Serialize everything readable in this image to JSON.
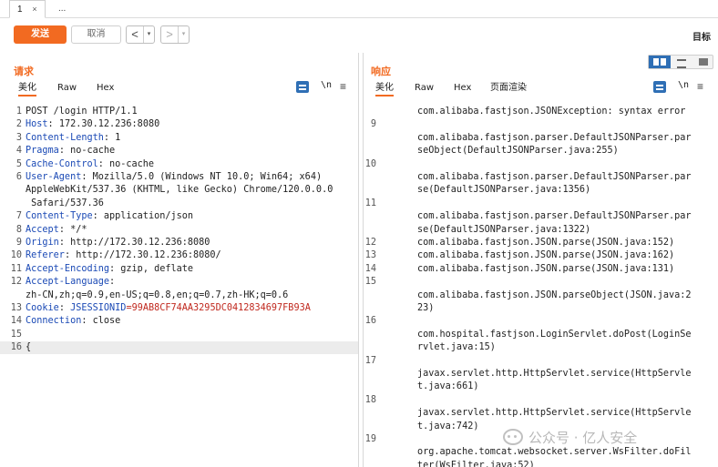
{
  "tabs": [
    {
      "label": "1",
      "close": "×"
    },
    {
      "label": "..."
    }
  ],
  "toolbar": {
    "send_label": "发送",
    "cancel_label": "取消",
    "back_arrow": "<",
    "forward_arrow": ">",
    "dropdown_glyph": "▾",
    "target_label": "目标"
  },
  "request": {
    "title": "请求",
    "subtabs": [
      "美化",
      "Raw",
      "Hex"
    ],
    "active_subtab": "美化",
    "newline_toggle": "\\n",
    "menu_glyph": "≡",
    "lines": [
      {
        "n": "1",
        "parts": [
          {
            "t": "POST /login HTTP/1.1",
            "c": "plain"
          }
        ]
      },
      {
        "n": "2",
        "parts": [
          {
            "t": "Host",
            "c": "hdr"
          },
          {
            "t": ": 172.30.12.236:8080",
            "c": "plain"
          }
        ]
      },
      {
        "n": "3",
        "parts": [
          {
            "t": "Content-Length",
            "c": "hdr"
          },
          {
            "t": ": 1",
            "c": "plain"
          }
        ]
      },
      {
        "n": "4",
        "parts": [
          {
            "t": "Pragma",
            "c": "hdr"
          },
          {
            "t": ": no-cache",
            "c": "plain"
          }
        ]
      },
      {
        "n": "5",
        "parts": [
          {
            "t": "Cache-Control",
            "c": "hdr"
          },
          {
            "t": ": no-cache",
            "c": "plain"
          }
        ]
      },
      {
        "n": "6",
        "parts": [
          {
            "t": "User-Agent",
            "c": "hdr"
          },
          {
            "t": ": Mozilla/5.0 (Windows NT 10.0; Win64; x64)",
            "c": "plain"
          }
        ]
      },
      {
        "n": "",
        "parts": [
          {
            "t": "AppleWebKit/537.36 (KHTML, like Gecko) Chrome/120.0.0.0",
            "c": "plain"
          }
        ]
      },
      {
        "n": "",
        "parts": [
          {
            "t": " Safari/537.36",
            "c": "plain"
          }
        ]
      },
      {
        "n": "7",
        "parts": [
          {
            "t": "Content-Type",
            "c": "hdr"
          },
          {
            "t": ": application/json",
            "c": "plain"
          }
        ]
      },
      {
        "n": "8",
        "parts": [
          {
            "t": "Accept",
            "c": "hdr"
          },
          {
            "t": ": */*",
            "c": "plain"
          }
        ]
      },
      {
        "n": "9",
        "parts": [
          {
            "t": "Origin",
            "c": "hdr"
          },
          {
            "t": ": http://172.30.12.236:8080",
            "c": "plain"
          }
        ]
      },
      {
        "n": "10",
        "parts": [
          {
            "t": "Referer",
            "c": "hdr"
          },
          {
            "t": ": http://172.30.12.236:8080/",
            "c": "plain"
          }
        ]
      },
      {
        "n": "11",
        "parts": [
          {
            "t": "Accept-Encoding",
            "c": "hdr"
          },
          {
            "t": ": gzip, deflate",
            "c": "plain"
          }
        ]
      },
      {
        "n": "12",
        "parts": [
          {
            "t": "Accept-Language",
            "c": "hdr"
          },
          {
            "t": ":",
            "c": "plain"
          }
        ]
      },
      {
        "n": "",
        "parts": [
          {
            "t": "zh-CN,zh;q=0.9,en-US;q=0.8,en;q=0.7,zh-HK;q=0.6",
            "c": "plain"
          }
        ]
      },
      {
        "n": "13",
        "parts": [
          {
            "t": "Cookie",
            "c": "hdr"
          },
          {
            "t": ": ",
            "c": "plain"
          },
          {
            "t": "JSESSIONID",
            "c": "hdr"
          },
          {
            "t": "=99AB8CF74AA3295DC0412834697FB93A",
            "c": "cookie-val"
          }
        ]
      },
      {
        "n": "14",
        "parts": [
          {
            "t": "Connection",
            "c": "hdr"
          },
          {
            "t": ": close",
            "c": "plain"
          }
        ]
      },
      {
        "n": "15",
        "parts": []
      },
      {
        "n": "16",
        "parts": [
          {
            "t": "{",
            "c": "plain"
          }
        ],
        "current": true
      }
    ]
  },
  "response": {
    "title": "响应",
    "subtabs": [
      "美化",
      "Raw",
      "Hex",
      "页面渲染"
    ],
    "active_subtab": "美化",
    "newline_toggle": "\\n",
    "menu_glyph": "≡",
    "lines": [
      {
        "n": "",
        "t": "com.alibaba.fastjson.JSONException: syntax error",
        "row": 0
      },
      {
        "n": "9",
        "t": "",
        "row": 1
      },
      {
        "n": "",
        "t": "com.alibaba.fastjson.parser.DefaultJSONParser.par",
        "row": 2
      },
      {
        "n": "",
        "t": "seObject(DefaultJSONParser.java:255)",
        "row": 3
      },
      {
        "n": "10",
        "t": "",
        "row": 4
      },
      {
        "n": "",
        "t": "com.alibaba.fastjson.parser.DefaultJSONParser.par",
        "row": 5
      },
      {
        "n": "",
        "t": "se(DefaultJSONParser.java:1356)",
        "row": 6
      },
      {
        "n": "11",
        "t": "",
        "row": 7
      },
      {
        "n": "",
        "t": "com.alibaba.fastjson.parser.DefaultJSONParser.par",
        "row": 8
      },
      {
        "n": "",
        "t": "se(DefaultJSONParser.java:1322)",
        "row": 9
      },
      {
        "n": "12",
        "t": "com.alibaba.fastjson.JSON.parse(JSON.java:152)",
        "row": 10
      },
      {
        "n": "13",
        "t": "com.alibaba.fastjson.JSON.parse(JSON.java:162)",
        "row": 11
      },
      {
        "n": "14",
        "t": "com.alibaba.fastjson.JSON.parse(JSON.java:131)",
        "row": 12
      },
      {
        "n": "15",
        "t": "",
        "row": 13
      },
      {
        "n": "",
        "t": "com.alibaba.fastjson.JSON.parseObject(JSON.java:2",
        "row": 14
      },
      {
        "n": "",
        "t": "23)",
        "row": 15
      },
      {
        "n": "16",
        "t": "",
        "row": 16
      },
      {
        "n": "",
        "t": "com.hospital.fastjson.LoginServlet.doPost(LoginSe",
        "row": 17
      },
      {
        "n": "",
        "t": "rvlet.java:15)",
        "row": 18
      },
      {
        "n": "17",
        "t": "",
        "row": 19
      },
      {
        "n": "",
        "t": "javax.servlet.http.HttpServlet.service(HttpServle",
        "row": 20
      },
      {
        "n": "",
        "t": "t.java:661)",
        "row": 21
      },
      {
        "n": "18",
        "t": "",
        "row": 22
      },
      {
        "n": "",
        "t": "javax.servlet.http.HttpServlet.service(HttpServle",
        "row": 23
      },
      {
        "n": "",
        "t": "t.java:742)",
        "row": 24
      },
      {
        "n": "19",
        "t": "",
        "row": 25
      },
      {
        "n": "",
        "t": "org.apache.tomcat.websocket.server.WsFilter.doFil",
        "row": 26
      },
      {
        "n": "",
        "t": "ter(WsFilter.java:52)",
        "row": 27
      }
    ]
  },
  "watermark": {
    "text": "公众号 · 亿人安全"
  }
}
